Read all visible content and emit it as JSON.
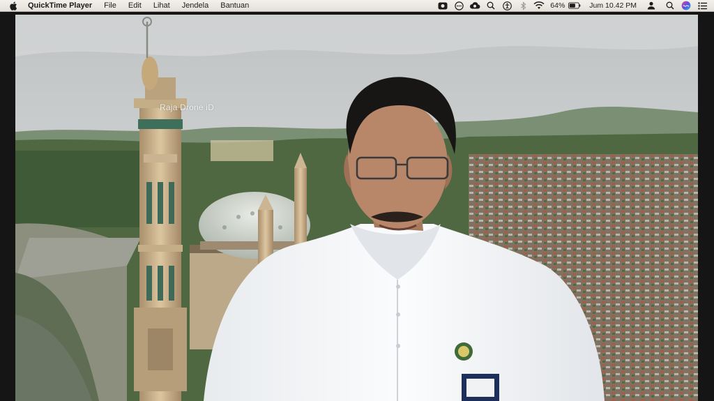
{
  "menubar": {
    "app_name": "QuickTime Player",
    "items": [
      "File",
      "Edit",
      "Lihat",
      "Jendela",
      "Bantuan"
    ],
    "battery_percent": "64%",
    "clock": "Jum 10.42 PM",
    "status_icons": [
      "screen-record-icon",
      "ellipsis-icon",
      "cloud-icon",
      "search-mini-icon",
      "accessibility-icon",
      "bluetooth-icon",
      "wifi-icon",
      "battery-icon",
      "user-icon",
      "spotlight-icon",
      "siri-icon",
      "control-center-icon"
    ]
  },
  "video": {
    "watermark": "Raja Drone iD"
  },
  "colors": {
    "menubar_bg": "#ece8e1",
    "shirt": "#f3f4f6",
    "sky": "#c7cbcc"
  }
}
